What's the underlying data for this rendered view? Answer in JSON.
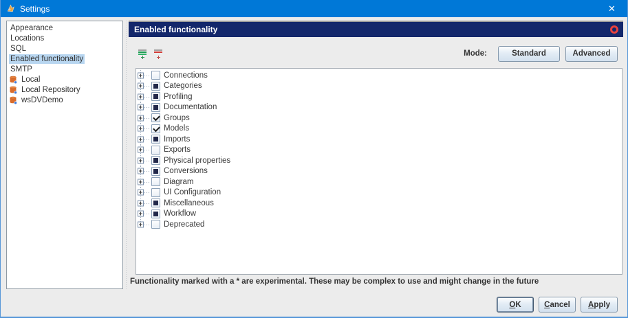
{
  "window": {
    "title": "Settings",
    "close_icon": "✕"
  },
  "sidebar": {
    "items": [
      {
        "label": "Appearance",
        "selected": false
      },
      {
        "label": "Locations",
        "selected": false
      },
      {
        "label": "SQL",
        "selected": false
      },
      {
        "label": "Enabled functionality",
        "selected": true
      },
      {
        "label": "SMTP",
        "selected": false
      },
      {
        "label": "Local",
        "selected": false,
        "icon": "database-icon"
      },
      {
        "label": "Local Repository",
        "selected": false,
        "icon": "database-icon"
      },
      {
        "label": "wsDVDemo",
        "selected": false,
        "icon": "database-icon"
      }
    ]
  },
  "main": {
    "header_title": "Enabled functionality",
    "toolbar": {
      "mode_label": "Mode:",
      "mode_buttons": [
        {
          "label": "Standard"
        },
        {
          "label": "Advanced"
        }
      ]
    },
    "tree": [
      {
        "label": "Connections",
        "state": "unchecked"
      },
      {
        "label": "Categories",
        "state": "partial"
      },
      {
        "label": "Profiling",
        "state": "partial"
      },
      {
        "label": "Documentation",
        "state": "partial"
      },
      {
        "label": "Groups",
        "state": "checked"
      },
      {
        "label": "Models",
        "state": "checked"
      },
      {
        "label": "Imports",
        "state": "partial"
      },
      {
        "label": "Exports",
        "state": "unchecked"
      },
      {
        "label": "Physical properties",
        "state": "partial"
      },
      {
        "label": "Conversions",
        "state": "partial"
      },
      {
        "label": "Diagram",
        "state": "unchecked"
      },
      {
        "label": "UI Configuration",
        "state": "unchecked"
      },
      {
        "label": "Miscellaneous",
        "state": "partial"
      },
      {
        "label": "Workflow",
        "state": "partial"
      },
      {
        "label": "Deprecated",
        "state": "unchecked"
      }
    ],
    "note": "Functionality marked with a * are experimental. These may be complex to use and might change in the future"
  },
  "footer": {
    "buttons": [
      {
        "label": "OK",
        "mnemonic": "O",
        "default": true
      },
      {
        "label": "Cancel",
        "mnemonic": "C",
        "default": false
      },
      {
        "label": "Apply",
        "mnemonic": "A",
        "default": false
      }
    ]
  },
  "colors": {
    "titlebar": "#0078d7",
    "header": "#13276b",
    "selection": "#b8d6f0",
    "window_border": "#5596d8",
    "status_red": "#e8413c"
  }
}
